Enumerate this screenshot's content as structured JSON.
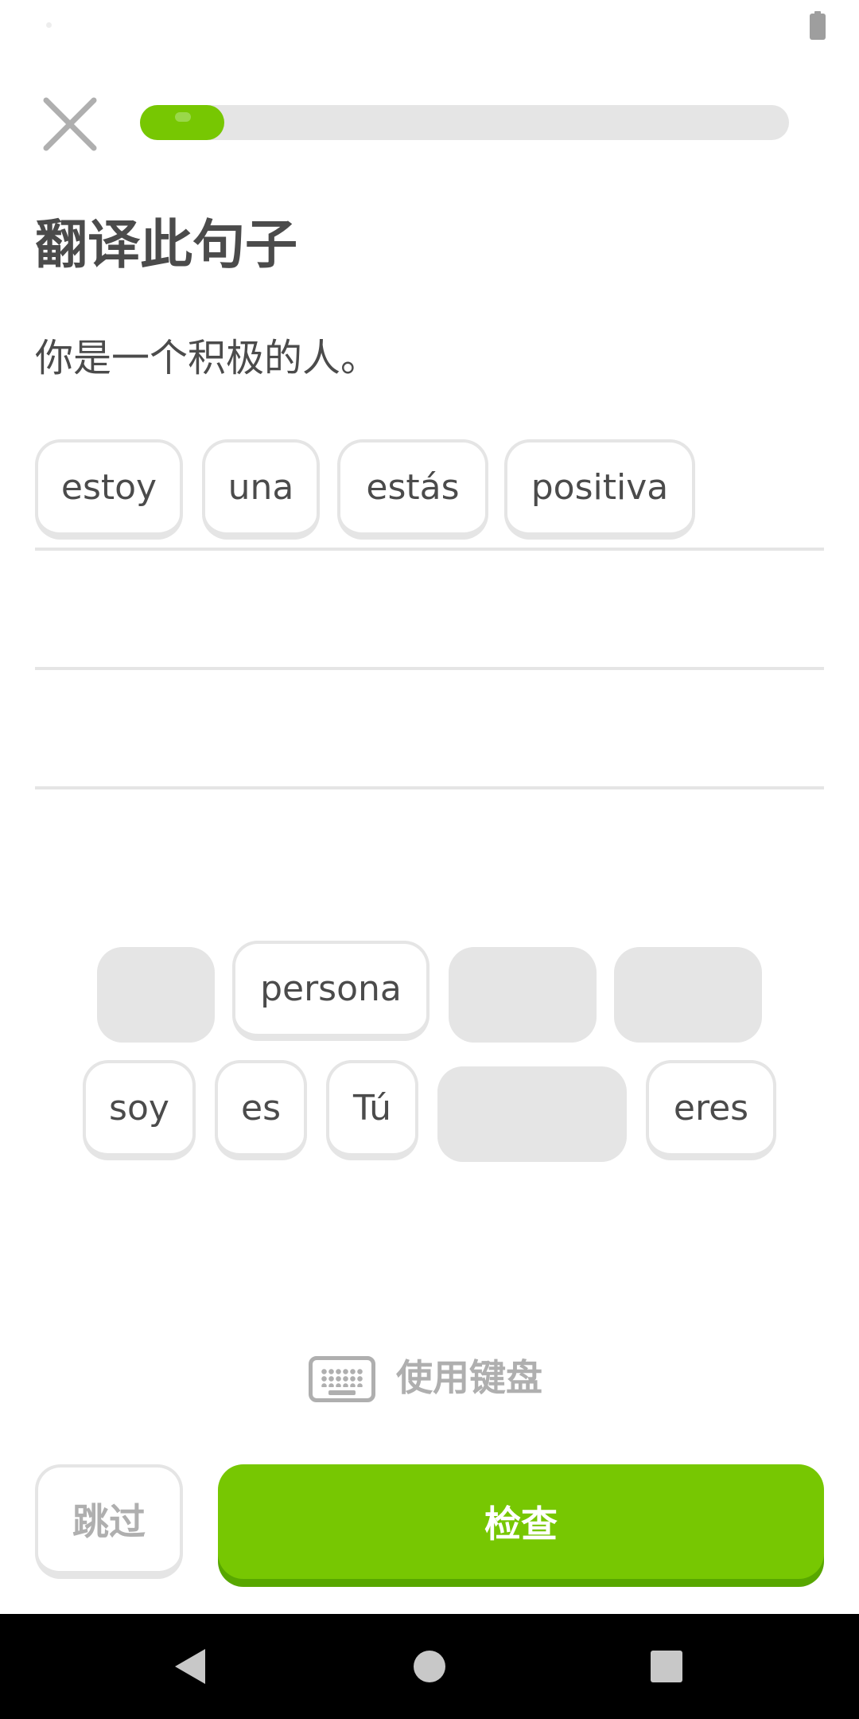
{
  "header": {
    "close_icon": "close-icon",
    "progress_percent": 13
  },
  "title": "翻译此句子",
  "prompt": "你是一个积极的人。",
  "answer_tiles": [
    "estoy",
    "una",
    "estás",
    "positiva"
  ],
  "word_bank": {
    "row1": [
      "",
      "persona",
      "",
      ""
    ],
    "row2": [
      "soy",
      "es",
      "Tú",
      "",
      "eres"
    ]
  },
  "keyboard_toggle": {
    "icon": "keyboard-icon",
    "label": "使用键盘"
  },
  "footer": {
    "skip_label": "跳过",
    "check_label": "检查"
  },
  "colors": {
    "accent_green": "#77c702",
    "accent_green_shadow": "#58a700",
    "tile_border": "#e5e5e5",
    "muted_text": "#afafaf",
    "body_text": "#4b4b4b"
  },
  "system_nav": {
    "back_icon": "back-triangle-icon",
    "home_icon": "home-circle-icon",
    "recents_icon": "recents-square-icon"
  }
}
